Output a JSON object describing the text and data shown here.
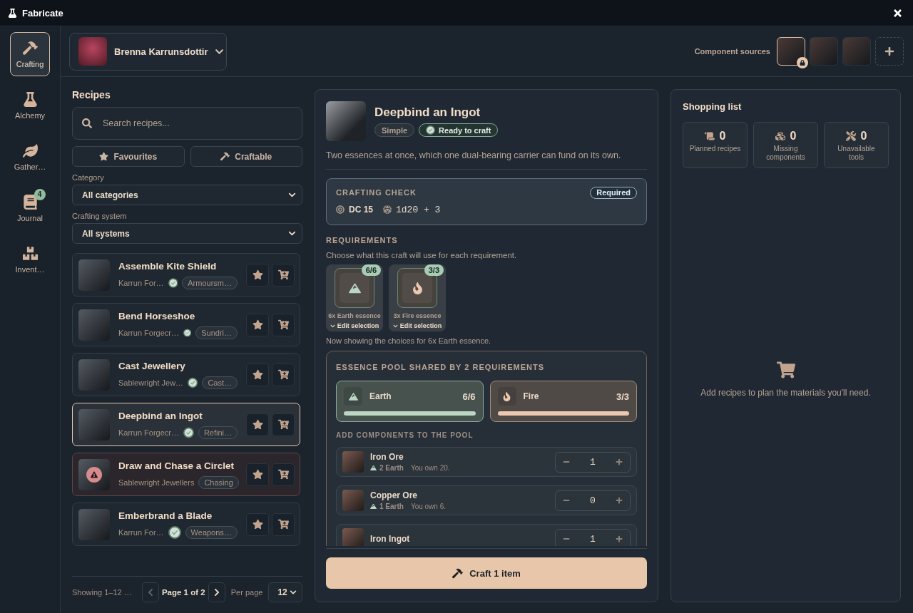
{
  "window": {
    "title": "Fabricate"
  },
  "nav": [
    {
      "label": "Crafting",
      "selected": true
    },
    {
      "label": "Alchemy",
      "selected": false
    },
    {
      "label": "Gather…",
      "selected": false
    },
    {
      "label": "Journal",
      "selected": false,
      "badge": "4"
    },
    {
      "label": "Invent…",
      "selected": false
    }
  ],
  "character": {
    "name": "Brenna Karrunsdottir"
  },
  "sources": {
    "label": "Component sources",
    "items": [
      {
        "selected": true,
        "locked": true
      },
      {
        "selected": false,
        "locked": false
      },
      {
        "selected": false,
        "locked": false
      }
    ]
  },
  "recipes": {
    "title": "Recipes",
    "search": {
      "placeholder": "Search recipes..."
    },
    "filters": [
      {
        "label": "Favourites",
        "selected": false
      },
      {
        "label": "Craftable",
        "selected": false
      }
    ],
    "category": {
      "label": "Category",
      "value": "All categories"
    },
    "system": {
      "label": "Crafting system",
      "value": "All systems"
    },
    "items": [
      {
        "name": "Assemble Kite Shield",
        "system": "Karrun For…",
        "category": "Armoursm…",
        "craftable": true,
        "selected": false
      },
      {
        "name": "Bend Horseshoe",
        "system": "Karrun Forgecr…",
        "category": "Sundri…",
        "craftable": true,
        "selected": false
      },
      {
        "name": "Cast Jewellery",
        "system": "Sablewright Jew…",
        "category": "Cast…",
        "craftable": true,
        "selected": false
      },
      {
        "name": "Deepbind an Ingot",
        "system": "Karrun Forgecr…",
        "category": "Refini…",
        "craftable": true,
        "selected": true
      },
      {
        "name": "Draw and Chase a Circlet",
        "system": "Sablewright Jewellers",
        "category": "Chasing",
        "craftable": false,
        "selected": false
      },
      {
        "name": "Emberbrand a Blade",
        "system": "Karrun For…",
        "category": "Weapons…",
        "craftable": true,
        "selected": false
      }
    ],
    "pagination": {
      "summary": "Showing 1–12 …",
      "previous": {
        "disabled": true
      },
      "page": "Page 1 of 2",
      "next": {
        "disabled": false
      },
      "per_page_label": "Per page",
      "per_page": "12"
    }
  },
  "detail": {
    "title": "Deepbind an Ingot",
    "tags": [
      {
        "label": "Simple",
        "kind": "plain"
      },
      {
        "label": "Ready to craft",
        "kind": "ready"
      }
    ],
    "description": "Two essences at once, which one dual-bearing carrier can fund on its own.",
    "check": {
      "title": "CRAFTING CHECK",
      "badge": "Required",
      "dc": "DC 15",
      "roll": "1d20 + 3"
    },
    "requirements": {
      "title": "REQUIREMENTS",
      "hint": "Choose what this craft will use for each requirement.",
      "items": [
        {
          "count": "6/6",
          "label": "6x Earth essence",
          "action": "Edit selection",
          "kind": "earth"
        },
        {
          "count": "3/3",
          "label": "3x Fire essence",
          "action": "Edit selection",
          "kind": "fire"
        }
      ],
      "note": "Now showing the choices for 6x Earth essence."
    },
    "pool": {
      "title": "ESSENCE POOL SHARED BY 2 REQUIREMENTS",
      "essences": [
        {
          "name": "Earth",
          "count": "6/6",
          "level": 1,
          "kind": "earth"
        },
        {
          "name": "Fire",
          "count": "3/3",
          "level": 1,
          "kind": "fire"
        }
      ],
      "subtitle": "ADD COMPONENTS TO THE POOL",
      "components": [
        {
          "name": "Iron Ore",
          "yields": [
            {
              "label": "2 Earth",
              "kind": "earth"
            }
          ],
          "owned": "You own 20.",
          "quantity": "1"
        },
        {
          "name": "Copper Ore",
          "yields": [
            {
              "label": "1 Earth",
              "kind": "earth"
            }
          ],
          "owned": "You own 6.",
          "quantity": "0"
        },
        {
          "name": "Iron Ingot",
          "quantity": "1"
        }
      ]
    },
    "craft_button": "Craft 1 item"
  },
  "shopping": {
    "title": "Shopping list",
    "stats": [
      {
        "value": "0",
        "label": "Planned recipes"
      },
      {
        "value": "0",
        "label": "Missing components"
      },
      {
        "value": "0",
        "label": "Unavailable tools"
      }
    ],
    "empty": "Add recipes to plan the materials you'll need."
  }
}
